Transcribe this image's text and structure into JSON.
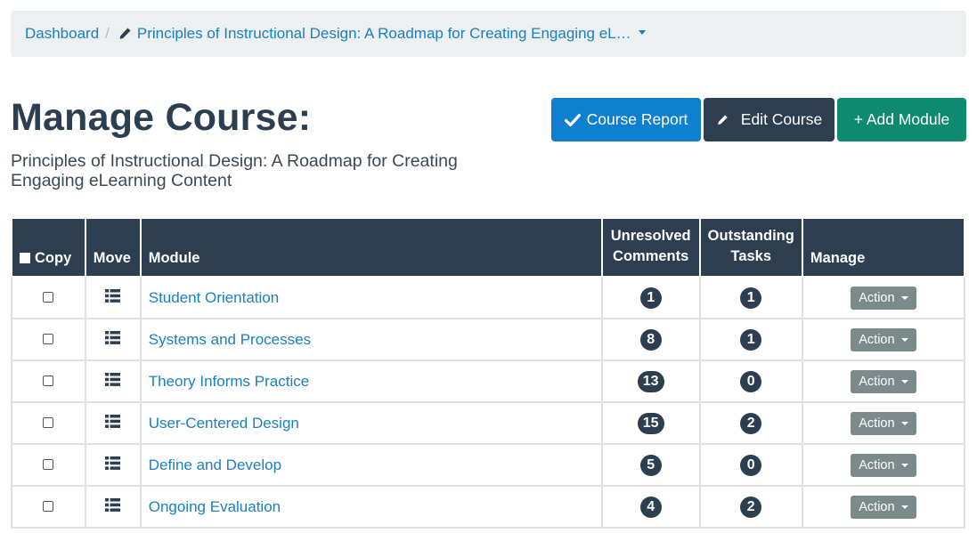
{
  "breadcrumb": {
    "home": "Dashboard",
    "separator": "/",
    "course": "Principles of Instructional Design: A Roadmap for Creating Engaging eL…"
  },
  "header": {
    "title": "Manage Course:",
    "subtitle": "Principles of Instructional Design: A Roadmap for Creating Engaging eLearning Content"
  },
  "buttons": {
    "report": "Course Report",
    "edit": "Edit Course",
    "add": "+ Add Module"
  },
  "table": {
    "headers": {
      "copy": "Copy",
      "move": "Move",
      "module": "Module",
      "unresolved_1": "Unresolved",
      "unresolved_2": "Comments",
      "outstanding_1": "Outstanding",
      "outstanding_2": "Tasks",
      "manage": "Manage"
    },
    "action_label": "Action",
    "rows": [
      {
        "module": "Student Orientation",
        "comments": "1",
        "tasks": "1"
      },
      {
        "module": "Systems and Processes",
        "comments": "8",
        "tasks": "1"
      },
      {
        "module": "Theory Informs Practice",
        "comments": "13",
        "tasks": "0"
      },
      {
        "module": "User-Centered Design",
        "comments": "15",
        "tasks": "2"
      },
      {
        "module": "Define and Develop",
        "comments": "5",
        "tasks": "0"
      },
      {
        "module": "Ongoing Evaluation",
        "comments": "4",
        "tasks": "2"
      }
    ]
  },
  "colors": {
    "primary_dark": "#2c3e50",
    "link_blue": "#1a7fc1",
    "report_blue": "#0f7fcf",
    "add_green": "#0e8a71",
    "action_gray": "#7b8a8b"
  },
  "icons": {
    "breadcrumb_course": "pencil-icon",
    "report": "check-icon",
    "edit": "pencil-icon",
    "move": "list-icon",
    "dropdown": "caret-down-icon"
  }
}
